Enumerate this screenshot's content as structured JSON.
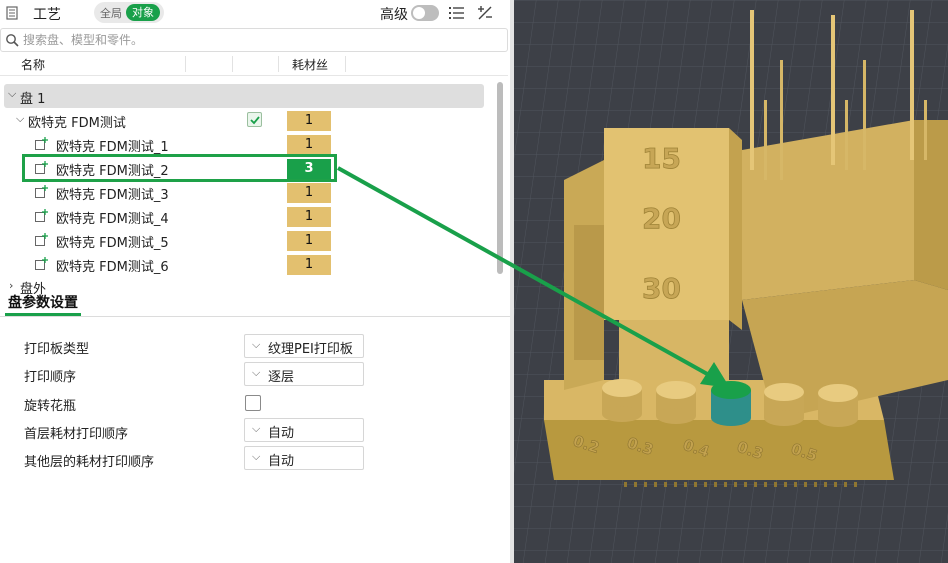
{
  "header": {
    "title": "工艺",
    "mode_global": "全局",
    "mode_object": "对象",
    "advanced_label": "高级",
    "advanced_on": false
  },
  "search": {
    "placeholder": "搜索盘、模型和零件。"
  },
  "columns": {
    "name": "名称",
    "filament": "耗材丝"
  },
  "tree": {
    "plate": "盘 1",
    "object": {
      "label": "欧特克 FDM测试",
      "checked": true,
      "filament": "1"
    },
    "parts": [
      {
        "label": "欧特克 FDM测试_1",
        "filament": "1"
      },
      {
        "label": "欧特克 FDM测试_2",
        "filament": "3"
      },
      {
        "label": "欧特克 FDM测试_3",
        "filament": "1"
      },
      {
        "label": "欧特克 FDM测试_4",
        "filament": "1"
      },
      {
        "label": "欧特克 FDM测试_5",
        "filament": "1"
      },
      {
        "label": "欧特克 FDM测试_6",
        "filament": "1"
      }
    ],
    "outside": "盘外"
  },
  "settings": {
    "title": "盘参数设置",
    "bed_type": {
      "label": "打印板类型",
      "value": "纹理PEI打印板"
    },
    "print_sequence": {
      "label": "打印顺序",
      "value": "逐层"
    },
    "spiral_vase": {
      "label": "旋转花瓶",
      "checked": false
    },
    "first_layer_order": {
      "label": "首层耗材打印顺序",
      "value": "自动"
    },
    "other_layer_order": {
      "label": "其他层的耗材打印顺序",
      "value": "自动"
    }
  },
  "model_labels": {
    "numbers": [
      "15",
      "20",
      "30"
    ],
    "bottom": [
      "0.2",
      "0.3",
      "0.4",
      "0.3",
      "0.5"
    ]
  },
  "colors": {
    "accent": "#19a04a",
    "filament_1": "#e3c06f",
    "filament_3": "#19a04a",
    "model": "#d9b765",
    "viewport_bg": "#3d4047",
    "highlight_part": "#2e8f8a"
  }
}
